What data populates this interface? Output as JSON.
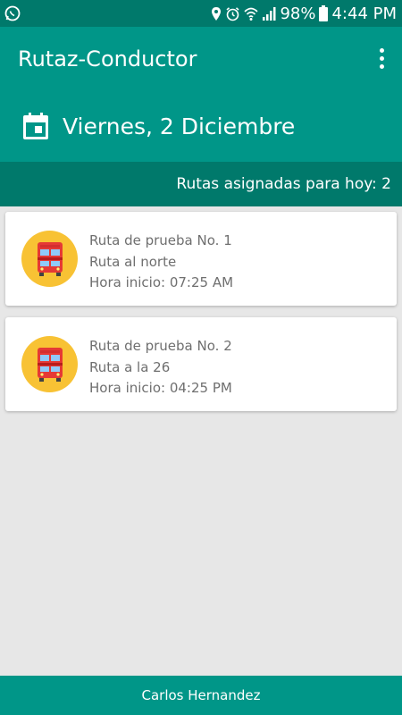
{
  "status_bar": {
    "battery": "98%",
    "time": "4:44 PM",
    "icons": [
      "whatsapp-icon",
      "location-icon",
      "alarm-icon",
      "wifi-icon",
      "signal-icon",
      "battery-icon"
    ]
  },
  "app_bar": {
    "title": "Rutaz-Conductor",
    "date": "Viernes, 2 Diciembre",
    "menu_icon": "more-vert-icon",
    "calendar_icon": "calendar-icon"
  },
  "summary": {
    "text": "Rutas asignadas para hoy: 2"
  },
  "routes": [
    {
      "name": "Ruta de prueba No. 1",
      "description": "Ruta al norte",
      "start": "Hora inicio: 07:25 AM",
      "icon": "bus-icon"
    },
    {
      "name": "Ruta de prueba No. 2",
      "description": "Ruta a la 26",
      "start": "Hora inicio: 04:25 PM",
      "icon": "bus-icon"
    }
  ],
  "footer": {
    "user": "Carlos Hernandez"
  },
  "colors": {
    "primary": "#009688",
    "primary_dark": "#00796b",
    "accent_avatar": "#f8c234",
    "bus_red": "#e53935"
  }
}
